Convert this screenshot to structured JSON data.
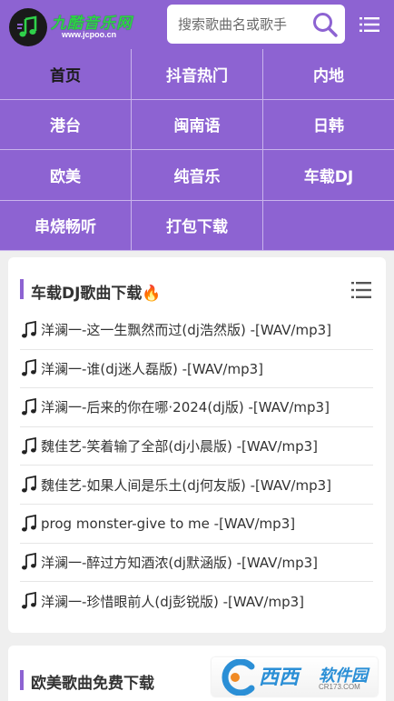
{
  "header": {
    "logo_text": "九酷音乐网",
    "logo_url": "www.jcpoo.cn",
    "search_placeholder": "搜索歌曲名或歌手"
  },
  "nav": {
    "items": [
      {
        "label": "首页",
        "active": true
      },
      {
        "label": "抖音热门"
      },
      {
        "label": "内地"
      },
      {
        "label": "港台"
      },
      {
        "label": "闽南语"
      },
      {
        "label": "日韩"
      },
      {
        "label": "欧美"
      },
      {
        "label": "纯音乐"
      },
      {
        "label": "车载DJ"
      },
      {
        "label": "串烧畅听"
      },
      {
        "label": "打包下载"
      }
    ]
  },
  "section1": {
    "title": "车载DJ歌曲下载🔥",
    "songs": [
      "洋澜一-这一生飘然而过(dj浩然版) -[WAV/mp3]",
      "洋澜一-谁(dj迷人磊版) -[WAV/mp3]",
      "洋澜一-后来的你在哪·2024(dj版) -[WAV/mp3]",
      "魏佳艺-笑着输了全部(dj小晨版) -[WAV/mp3]",
      "魏佳艺-如果人间是乐土(dj何友版) -[WAV/mp3]",
      "prog monster-give to me -[WAV/mp3]",
      "洋澜一-醉过方知酒浓(dj默涵版) -[WAV/mp3]",
      "洋澜一-珍惜眼前人(dj彭锐版) -[WAV/mp3]"
    ]
  },
  "section2": {
    "title": "欧美歌曲免费下载"
  },
  "watermark": {
    "text": "西西",
    "text2": "软件园",
    "sub": "CR173.COM"
  },
  "colors": {
    "accent": "#8d63d2",
    "logo_green": "#2fd14a"
  }
}
